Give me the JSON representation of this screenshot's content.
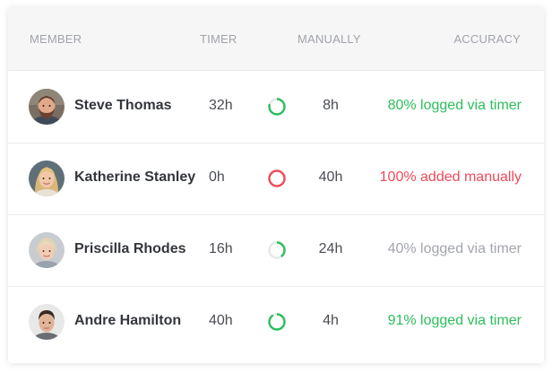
{
  "header": {
    "member": "MEMBER",
    "timer": "TIMER",
    "manually": "MANUALLY",
    "accuracy": "ACCURACY"
  },
  "colors": {
    "green": "#2bbf5c",
    "red": "#ef4a59",
    "gray": "#a3a6ad",
    "ring_track": "#e6e7ea"
  },
  "members": [
    {
      "name": "Steve Thomas",
      "timer": "32h",
      "manually": "8h",
      "accuracy": "80% logged via timer",
      "timer_fraction": 0.8,
      "status": "green",
      "avatar": "bearded-man"
    },
    {
      "name": "Katherine Stanley",
      "timer": "0h",
      "manually": "40h",
      "accuracy": "100% added manually",
      "timer_fraction": 0.0,
      "status": "red",
      "avatar": "blonde-woman"
    },
    {
      "name": "Priscilla Rhodes",
      "timer": "16h",
      "manually": "24h",
      "accuracy": "40% logged via timer",
      "timer_fraction": 0.4,
      "status": "gray",
      "avatar": "older-woman"
    },
    {
      "name": "Andre Hamilton",
      "timer": "40h",
      "manually": "4h",
      "accuracy": "91% logged via timer",
      "timer_fraction": 0.91,
      "status": "green",
      "avatar": "young-man"
    }
  ]
}
